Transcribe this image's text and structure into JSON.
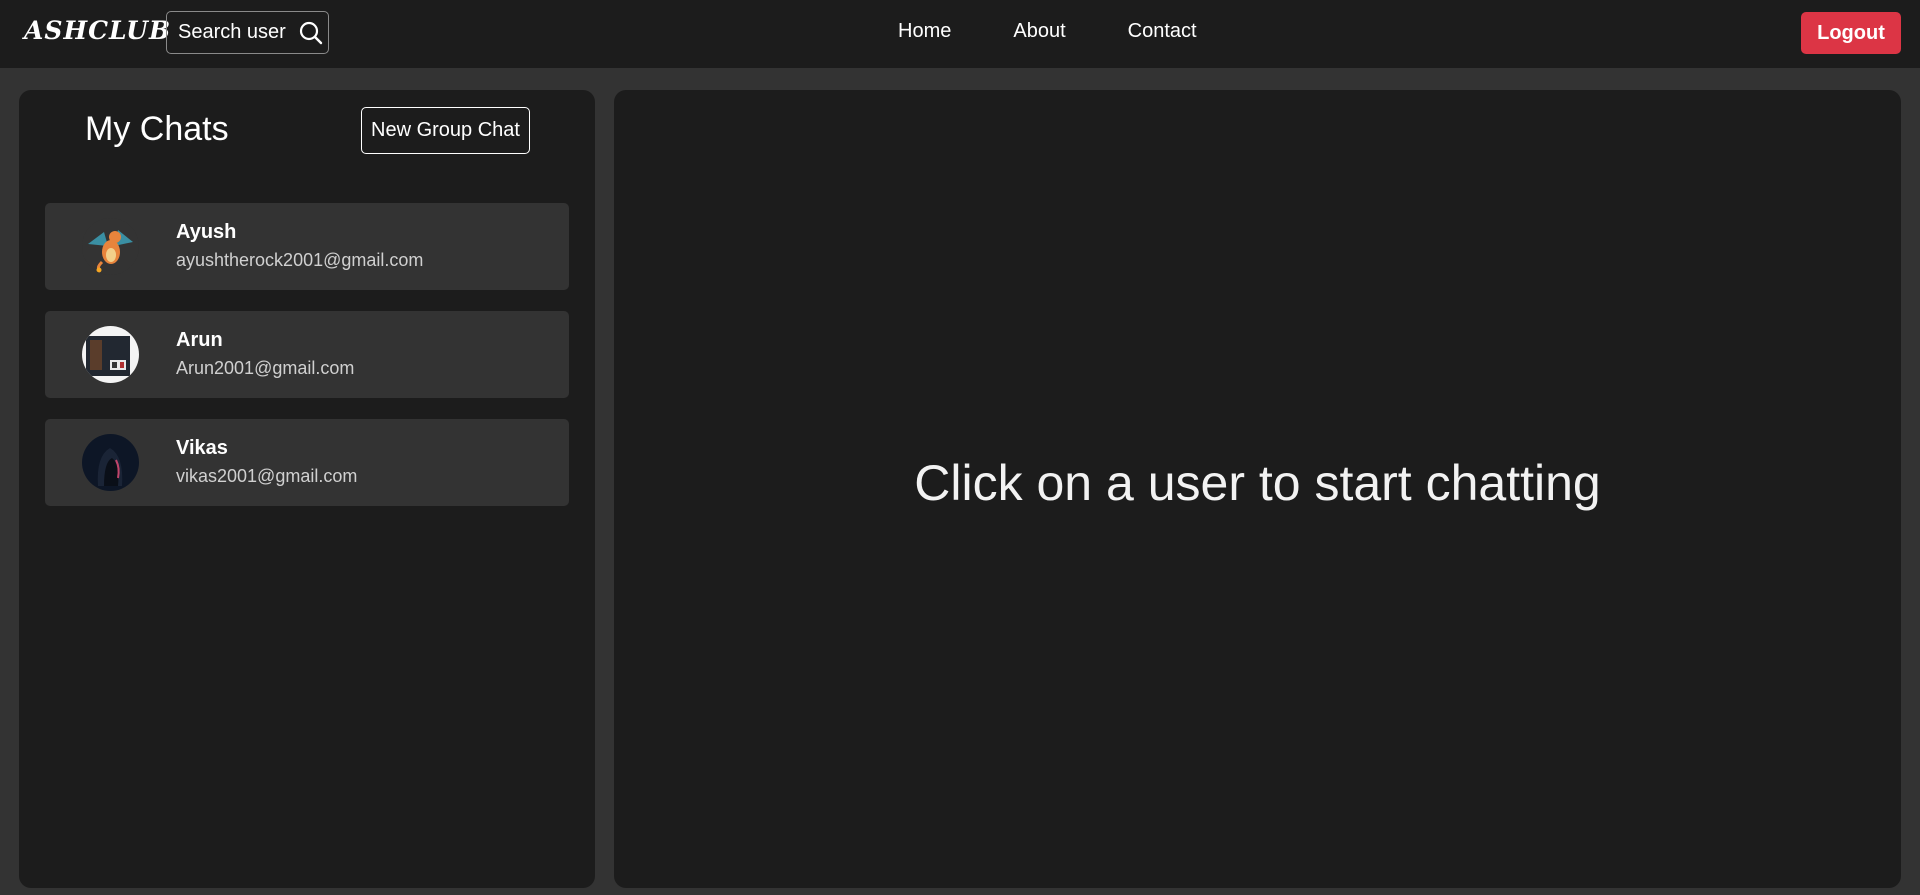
{
  "navbar": {
    "brand": "ASHCLUB",
    "search_label": "Search user",
    "links": [
      "Home",
      "About",
      "Contact"
    ],
    "logout_label": "Logout"
  },
  "sidebar": {
    "title": "My Chats",
    "new_group_label": "New Group Chat",
    "chats": [
      {
        "name": "Ayush",
        "email": "ayushtherock2001@gmail.com",
        "avatar": "dragon-avatar"
      },
      {
        "name": "Arun",
        "email": "Arun2001@gmail.com",
        "avatar": "photo-avatar"
      },
      {
        "name": "Vikas",
        "email": "vikas2001@gmail.com",
        "avatar": "hooded-figure-avatar"
      }
    ]
  },
  "main": {
    "empty_message": "Click on a user to start chatting"
  },
  "colors": {
    "page_bg": "#333333",
    "panel_bg": "#1c1c1c",
    "chat_item_bg": "#333333",
    "logout_red": "#dc3545"
  }
}
